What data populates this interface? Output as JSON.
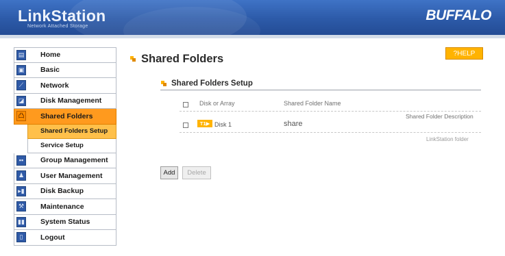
{
  "header": {
    "logo": "LinkStation",
    "logo_subtitle": "Network Attached Storage",
    "brand": "BUFFALO"
  },
  "sidebar": {
    "items": [
      {
        "label": "Home",
        "icon": "home-icon",
        "glyph": "▤"
      },
      {
        "label": "Basic",
        "icon": "basic-icon",
        "glyph": "▣"
      },
      {
        "label": "Network",
        "icon": "network-icon",
        "glyph": "⟋"
      },
      {
        "label": "Disk Management",
        "icon": "disk-management-icon",
        "glyph": "◪"
      },
      {
        "label": "Shared Folders",
        "icon": "shared-folders-icon",
        "glyph": "凸",
        "active": true
      },
      {
        "label": "Group Management",
        "icon": "group-icon",
        "glyph": "▪▪"
      },
      {
        "label": "User Management",
        "icon": "user-icon",
        "glyph": "♟"
      },
      {
        "label": "Disk Backup",
        "icon": "backup-icon",
        "glyph": "▸▮"
      },
      {
        "label": "Maintenance",
        "icon": "maintenance-icon",
        "glyph": "⚒"
      },
      {
        "label": "System Status",
        "icon": "status-icon",
        "glyph": "▮▮"
      },
      {
        "label": "Logout",
        "icon": "logout-icon",
        "glyph": "▯"
      }
    ],
    "subitems": [
      {
        "label": "Shared Folders Setup",
        "active": true
      },
      {
        "label": "Service Setup"
      }
    ]
  },
  "main": {
    "title": "Shared Folders",
    "help_label": "?HELP",
    "section_title": "Shared Folders Setup",
    "table": {
      "columns": [
        "Disk or Array",
        "Shared Folder Name",
        "Shared Folder Description"
      ],
      "rows": [
        {
          "tag": "T1▶",
          "disk": "Disk 1",
          "name": "share",
          "description": "LinkStation folder"
        }
      ]
    },
    "buttons": {
      "add": "Add",
      "delete": "Delete"
    }
  },
  "colors": {
    "header_blue": "#2c5aa8",
    "active_orange": "#ff9a1e",
    "help_orange": "#ffb300"
  }
}
